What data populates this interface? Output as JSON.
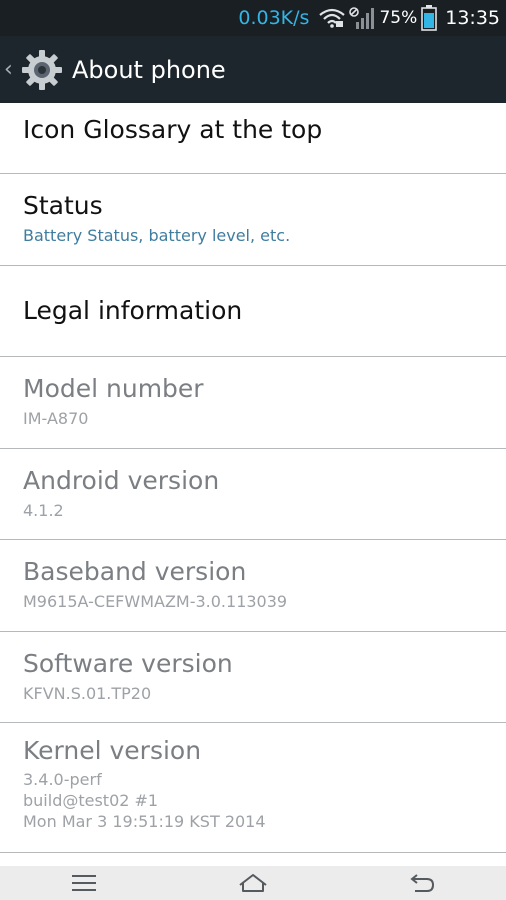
{
  "status_bar": {
    "speed": "0.03K/s",
    "battery_percent": "75%",
    "time": "13:35",
    "icons": [
      "wifi-icon",
      "signal-icon",
      "battery-icon"
    ]
  },
  "action_bar": {
    "title": "About phone",
    "back_icon": "chevron-left-icon",
    "app_icon": "gear-icon"
  },
  "items": [
    {
      "title": "Icon Glossary at the top",
      "subtitle": ""
    },
    {
      "title": "Status",
      "subtitle": "Battery Status, battery level, etc."
    },
    {
      "title": "Legal information",
      "subtitle": ""
    },
    {
      "title": "Model number",
      "subtitle": "IM-A870"
    },
    {
      "title": "Android version",
      "subtitle": "4.1.2"
    },
    {
      "title": "Baseband version",
      "subtitle": "M9615A-CEFWMAZM-3.0.113039"
    },
    {
      "title": "Software version",
      "subtitle": "KFVN.S.01.TP20"
    },
    {
      "title": "Kernel version",
      "subtitle_lines": [
        "3.4.0-perf",
        "build@test02 #1",
        "Mon Mar 3 19:51:19 KST 2014"
      ]
    }
  ],
  "nav_bar": {
    "icons": [
      "menu-icon",
      "home-icon",
      "back-icon"
    ]
  },
  "colors": {
    "accent": "#33b5e5",
    "summary_blue": "#3f7da0",
    "action_bar_bg": "#1d262c"
  }
}
